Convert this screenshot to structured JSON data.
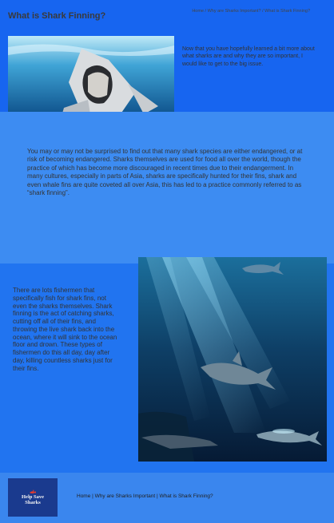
{
  "header": {
    "title": "What is Shark Finning?",
    "breadcrumb": {
      "home": "Home",
      "sep1": " / ",
      "important": "Why are Sharks Important?",
      "sep2": " / ",
      "current": "What is Shark Finning?"
    }
  },
  "intro": {
    "text": "Now that you have hopefully learned a bit more about what sharks are and why they are so important, I would like to get to the big issue."
  },
  "section2": {
    "text": "You may or may not be surprised to find out that many shark species are either endangered, or at risk of becoming endangered. Sharks themselves are used for food all over the world, though the practice of which has become more discouraged in recent times due to their endangerment. In many cultures, especially in parts of Asia, sharks are specifically hunted for their fins, shark and even whale fins are quite coveted all over Asia, this has led to a practice commonly referred to as “shark finning”."
  },
  "section3": {
    "text": "There are lots fishermen that specifically fish for shark fins, not even the sharks themselves. Shark finning is the act of catching sharks, cutting off all of their fins, and throwing the live shark back into the ocean, where it will sink to the ocean floor and drown. These types of fishermen do this all day, day after day, killing countless sharks just for their fins."
  },
  "footer": {
    "logo": {
      "line1": "Help Save",
      "line2": "Sharks"
    },
    "nav": {
      "home": "Home",
      "sep1": " | ",
      "important": "Why are Sharks Important",
      "sep2": " | ",
      "finning": "What is Shark Finning?"
    }
  },
  "icons": {
    "logo": "shark-icon"
  },
  "colors": {
    "header_bg": "#1765f0",
    "band2_bg": "#3d8cf2",
    "band3_bg": "#2174f0",
    "footer_bg": "#3a86ee",
    "logo_bg": "#1a3a8e"
  }
}
